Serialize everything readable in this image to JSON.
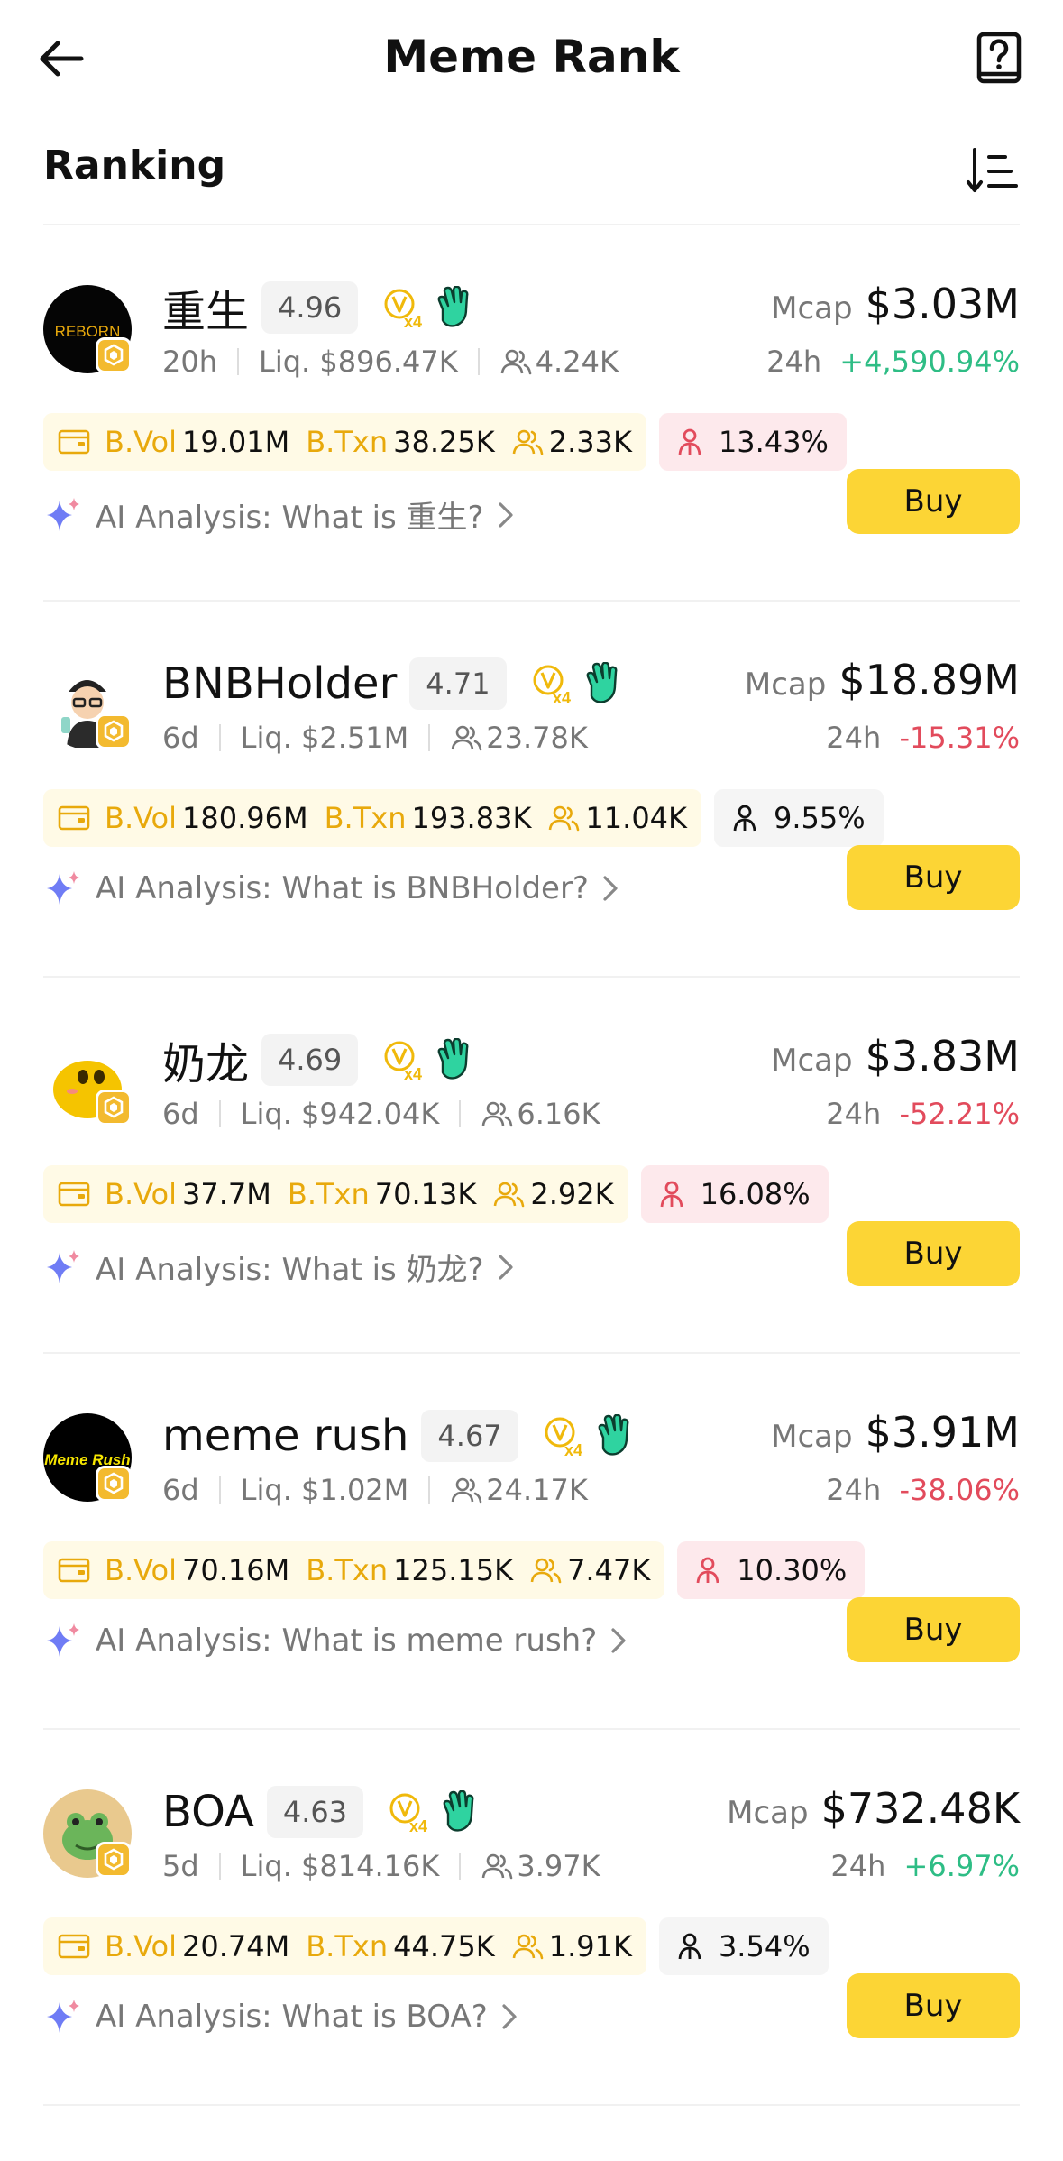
{
  "header": {
    "title": "Meme Rank"
  },
  "section": {
    "title": "Ranking"
  },
  "labels": {
    "mcap": "Mcap",
    "change": "24h",
    "vol": "B.Vol",
    "txn": "B.Txn",
    "buy": "Buy",
    "ai_prefix": "AI Analysis: What is "
  },
  "colors": {
    "accent": "#FCD535",
    "positive": "#2EBD85",
    "negative": "#E24B5C"
  },
  "tokens": [
    {
      "name": "重生",
      "score": "4.96",
      "age": "20h",
      "liq": "Liq. $896.47K",
      "holders": "4.24K",
      "mcap": "$3.03M",
      "change": "+4,590.94%",
      "dir": "pos",
      "vol": "19.01M",
      "txn": "38.25K",
      "traders": "2.33K",
      "top_holders": "13.43%",
      "top_style": "red",
      "ai": "AI Analysis: What is 重生?",
      "avatar": "reborn"
    },
    {
      "name": "BNBHolder",
      "score": "4.71",
      "age": "6d",
      "liq": "Liq. $2.51M",
      "holders": "23.78K",
      "mcap": "$18.89M",
      "change": "-15.31%",
      "dir": "neg",
      "vol": "180.96M",
      "txn": "193.83K",
      "traders": "11.04K",
      "top_holders": "9.55%",
      "top_style": "gray",
      "ai": "AI Analysis: What is BNBHolder?",
      "avatar": "bnbholder"
    },
    {
      "name": "奶龙",
      "score": "4.69",
      "age": "6d",
      "liq": "Liq. $942.04K",
      "holders": "6.16K",
      "mcap": "$3.83M",
      "change": "-52.21%",
      "dir": "neg",
      "vol": "37.7M",
      "txn": "70.13K",
      "traders": "2.92K",
      "top_holders": "16.08%",
      "top_style": "red",
      "ai": "AI Analysis: What is 奶龙?",
      "avatar": "nailong"
    },
    {
      "name": "meme rush",
      "score": "4.67",
      "age": "6d",
      "liq": "Liq. $1.02M",
      "holders": "24.17K",
      "mcap": "$3.91M",
      "change": "-38.06%",
      "dir": "neg",
      "vol": "70.16M",
      "txn": "125.15K",
      "traders": "7.47K",
      "top_holders": "10.30%",
      "top_style": "red",
      "ai": "AI Analysis: What is meme rush?",
      "avatar": "memerush"
    },
    {
      "name": "BOA",
      "score": "4.63",
      "age": "5d",
      "liq": "Liq. $814.16K",
      "holders": "3.97K",
      "mcap": "$732.48K",
      "change": "+6.97%",
      "dir": "pos",
      "vol": "20.74M",
      "txn": "44.75K",
      "traders": "1.91K",
      "top_holders": "3.54%",
      "top_style": "gray",
      "ai": "AI Analysis: What is BOA?",
      "avatar": "boa"
    }
  ]
}
